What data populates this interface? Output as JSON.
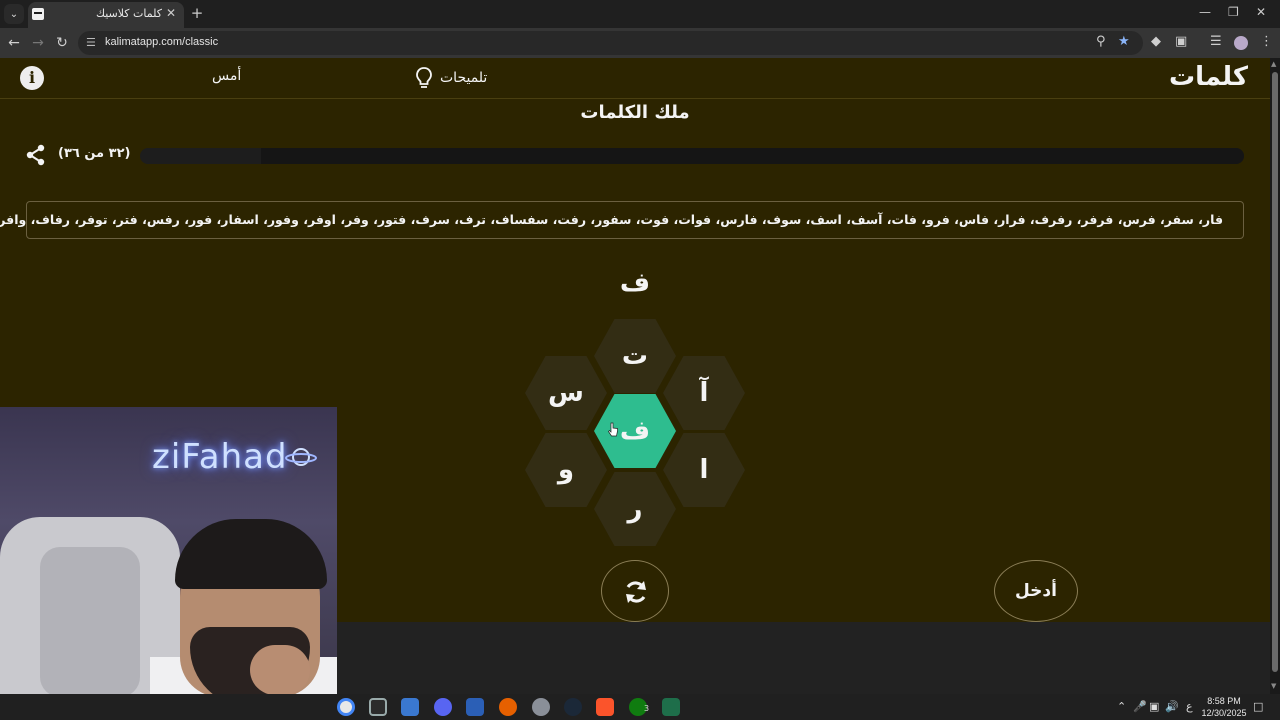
{
  "browser": {
    "tab_title": "كلمات كلاسيك",
    "tab_close": "✕",
    "new_tab": "+",
    "tab_list": "⌄",
    "url": "kalimatapp.com/classic",
    "win_minimize": "—",
    "win_restore": "❐",
    "win_close": "✕"
  },
  "header": {
    "logo": "كلمات",
    "hints_label": "تلميحات",
    "yesterday_label": "أمس",
    "info_glyph": "i"
  },
  "game": {
    "rank_title": "ملك الكلمات",
    "progress_text": "(٣٢ من ٣٦)",
    "progress": 0.89,
    "found_words": "فار، سفر، فرس، فرفر، رفرف، فرار، فاس، فرو، فات، آسف، اسف، سوف، فارس، فوات، فوت، سفور، رفت، سفساف، ترف، سرف، فتور، وفر، اوفر، وفور، اسفار، فور، رفس، فتر، توفر، رفاف، وافر، رفاس",
    "typed_letter": "ف",
    "letters": {
      "top": "ت",
      "upper_left": "س",
      "upper_right": "آ",
      "center": "ف",
      "lower_left": "و",
      "lower_right": "ا",
      "bottom": "ر"
    },
    "enter_label": "أدخل"
  },
  "webcam": {
    "neon_text": "ziFahad"
  },
  "taskbar": {
    "ime": "ع",
    "time": "8:58 PM",
    "date": "12/30/2025",
    "notif_badge": "3"
  },
  "colors": {
    "app_bg": "#2c2400",
    "hex_bg": "#332d14",
    "center_hex": "#2ebd8f",
    "text": "#f4f4f4"
  }
}
